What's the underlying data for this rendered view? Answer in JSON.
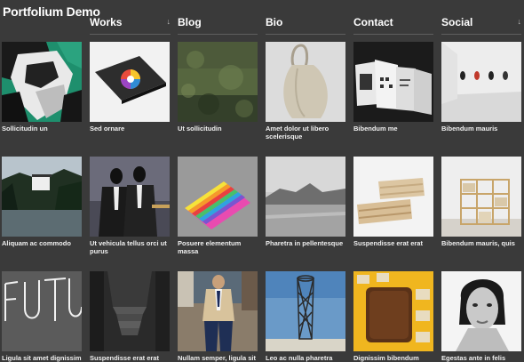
{
  "site": {
    "title": "Portfolium Demo"
  },
  "nav": [
    {
      "label": "Works",
      "arrow": "↓"
    },
    {
      "label": "Blog",
      "arrow": ""
    },
    {
      "label": "Bio",
      "arrow": ""
    },
    {
      "label": "Contact",
      "arrow": ""
    },
    {
      "label": "Social",
      "arrow": "↓"
    }
  ],
  "rows": [
    [
      {
        "caption": "Sollicitudin un",
        "art": "portrait-collage"
      },
      {
        "caption": "Sed ornare",
        "art": "color-wheel-book"
      },
      {
        "caption": "Ut sollicitudin",
        "art": "forest-moss"
      },
      {
        "caption": "Amet dolor ut libero scelerisque",
        "art": "tote-bag"
      },
      {
        "caption": "Bibendum me",
        "art": "print-booklets"
      },
      {
        "caption": "Bibendum mauris",
        "art": "gallery-room"
      }
    ],
    [
      {
        "caption": "Aliquam ac commodo",
        "art": "lake-house"
      },
      {
        "caption": "Ut vehicula tellus orci ut purus",
        "art": "suited-figures"
      },
      {
        "caption": "Posuere elementum massa",
        "art": "rainbow-book"
      },
      {
        "caption": "Pharetra in pellentesque",
        "art": "misty-coast"
      },
      {
        "caption": "Suspendisse erat erat",
        "art": "wood-pallet"
      },
      {
        "caption": "Bibendum mauris, quis",
        "art": "shelving-unit"
      }
    ],
    [
      {
        "caption": "Ligula sit amet dignissim",
        "art": "futu-lettering"
      },
      {
        "caption": "Suspendisse erat erat",
        "art": "concrete-stair"
      },
      {
        "caption": "Nullam semper, ligula sit",
        "art": "street-style"
      },
      {
        "caption": "Leo ac nulla pharetra",
        "art": "lattice-tower"
      },
      {
        "caption": "Dignissim bibendum",
        "art": "chocolate-pieces"
      },
      {
        "caption": "Egestas ante in felis",
        "art": "bw-portrait"
      }
    ]
  ]
}
